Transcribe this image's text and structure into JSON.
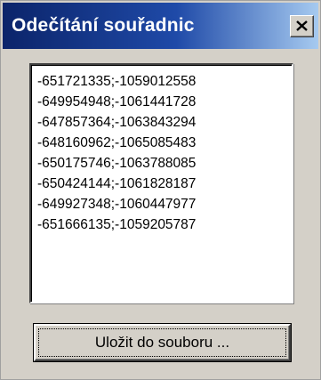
{
  "window": {
    "title": "Odečítání souřadnic",
    "close_icon": "close-icon"
  },
  "coordinates_list": {
    "items": [
      "-651721335;-1059012558",
      "-649954948;-1061441728",
      "-647857364;-1063843294",
      "-648160962;-1065085483",
      "-650175746;-1063788085",
      "-650424144;-1061828187",
      "-649927348;-1060447977",
      "-651666135;-1059205787"
    ]
  },
  "actions": {
    "save_label": "Uložit do souboru ..."
  },
  "colors": {
    "titlebar_start": "#0b246a",
    "titlebar_end": "#a6caf0",
    "face": "#d4d0c8",
    "list_background": "#ffffff"
  }
}
